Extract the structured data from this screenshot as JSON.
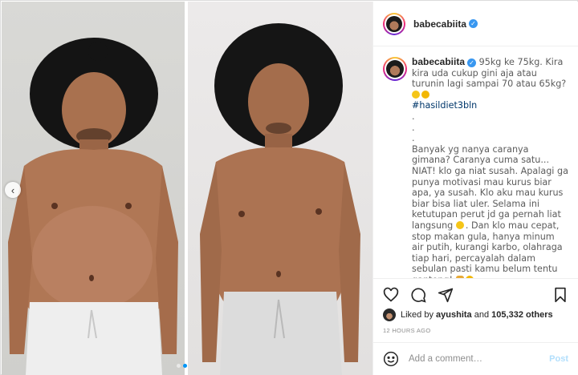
{
  "post": {
    "username": "babecabiita",
    "verified_icon": "verified-badge-icon",
    "caption": {
      "username": "babecabiita",
      "intro": "95kg ke 75kg. Kira kira uda cukup gini aja atau turunin lagi sampai 70 atau 65kg?",
      "hashtag": "#hasildiet3bln",
      "dot1": ".",
      "dot2": ".",
      "dot3": ".",
      "body": "Banyak yg nanya caranya gimana? Caranya cuma satu... NIAT! klo ga niat susah. Apalagi ga punya motivasi mau kurus biar apa, ya susah. Klo aku mau kurus biar bisa liat uler. Selama ini ketutupan perut jd ga pernah liat langsung",
      "body2": ". Dan klo mau cepat, stop makan gula, hanya minum air putih, kurangi karbo, olahraga tiap hari, percayalah dalam sebulan pasti kamu belum tentu ganteng!",
      "dot4": "."
    },
    "likes": {
      "prefix": "Liked by",
      "user": "ayushita",
      "and": "and",
      "count": "105,332 others"
    },
    "timestamp": "12 HOURS AGO",
    "comment": {
      "placeholder": "Add a comment…",
      "post_label": "Post"
    },
    "carousel": {
      "prev_label": "‹",
      "slides": 2,
      "active_slide": 1
    }
  },
  "icons": [
    "heart-icon",
    "comment-icon",
    "share-icon",
    "bookmark-icon",
    "emoji-icon",
    "chevron-left-icon"
  ],
  "colors": {
    "accent": "#0095f6",
    "verified": "#3897f0",
    "hashtag": "#00376b",
    "post_button": "#b2dffc",
    "muted": "#8e8e8e"
  }
}
